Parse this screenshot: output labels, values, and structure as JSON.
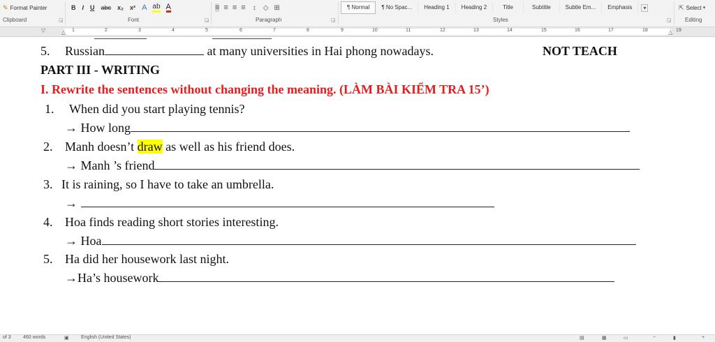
{
  "ribbon": {
    "format_painter": "Format Painter",
    "font_buttons": [
      "B",
      "I",
      "U",
      "abc",
      "x₂",
      "x²"
    ],
    "styles": [
      "¶ Normal",
      "¶ No Spac...",
      "Heading 1",
      "Heading 2",
      "Title",
      "Subtitle",
      "Subtle Em...",
      "Emphasis"
    ],
    "select_label": "Select",
    "groups": {
      "clipboard": "Clipboard",
      "font": "Font",
      "paragraph": "Paragraph",
      "styles": "Styles",
      "editing": "Editing"
    }
  },
  "ruler": {
    "numbers": [
      "1",
      "2",
      "3",
      "4",
      "5",
      "6",
      "7",
      "8",
      "9",
      "10",
      "11",
      "12",
      "13",
      "14",
      "15",
      "16",
      "17",
      "18",
      "19"
    ]
  },
  "document": {
    "q5": {
      "num": "5.",
      "before": "Russian",
      "after": "at many universities in Hai phong nowadays.",
      "tag": "NOT TEACH"
    },
    "part_heading": "PART III - WRITING",
    "section_heading": "I. Rewrite the sentences without changing the meaning.  (LÀM BÀI KIỂM TRA 15’)",
    "items": [
      {
        "num": "1.",
        "sentence": "When did you start playing tennis?",
        "prompt": "→ How long"
      },
      {
        "num": "2.",
        "sentence_before": "Manh doesn’t",
        "highlight": "draw",
        "sentence_after": "as well as his friend does.",
        "prompt": "→ Manh ’s friend"
      },
      {
        "num": "3.",
        "sentence": "It is raining, so I have to take an umbrella.",
        "prompt": "→"
      },
      {
        "num": "4.",
        "sentence": "Hoa finds reading short stories interesting.",
        "prompt": "→ Hoa"
      },
      {
        "num": "5.",
        "sentence": "Ha did her housework last night.",
        "prompt": "→Ha’s housework"
      }
    ]
  },
  "status": {
    "page": "of 3",
    "words": "460 words",
    "language": "English (United States)"
  },
  "colors": {
    "heading_red": "#e0201f",
    "highlight": "#ffff00",
    "ribbon_bg": "#f3f3f3"
  }
}
